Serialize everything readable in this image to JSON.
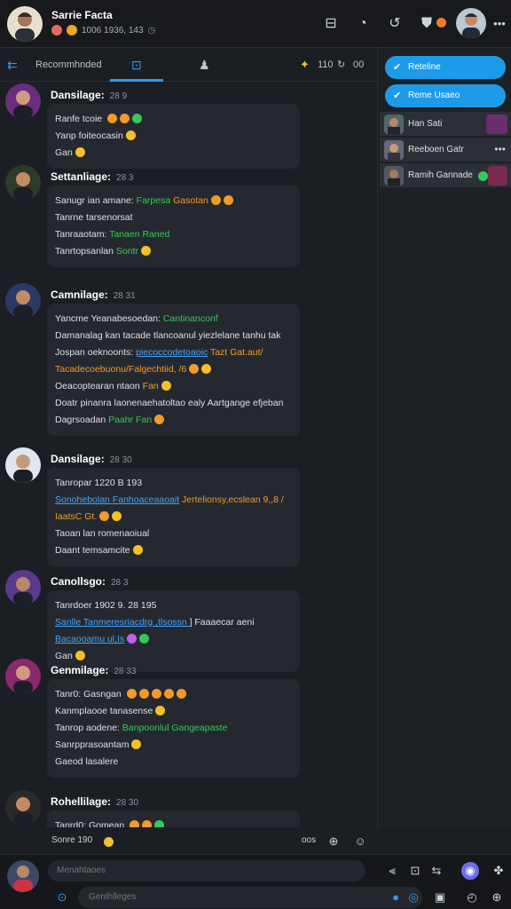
{
  "header": {
    "title": "Sarrie Facta",
    "subtitle": "1006 1936, 143",
    "icons": [
      "chat-icon",
      "bubble-icon",
      "share-icon",
      "reward-icon",
      "notification-badge-icon",
      "more-icon"
    ]
  },
  "subnav": {
    "back_label": "Recommhnded",
    "tab_active_icon": "box-icon",
    "tab2_icon": "person-icon",
    "stats": {
      "a": "110",
      "b": "00"
    }
  },
  "posts": [
    {
      "user": "Dansilage:",
      "time": "28 9",
      "lines": [
        {
          "parts": [
            {
              "t": "Ranfe tcoie "
            }
          ],
          "emojis": [
            "#f39a2a",
            "#f39a2a",
            "#35c85a"
          ]
        },
        {
          "parts": [
            {
              "t": "Yanp foiteocasin"
            }
          ],
          "emojis": [
            "#f3c12a"
          ]
        },
        {
          "parts": [
            {
              "t": "Gan"
            }
          ],
          "emojis": [
            "#f3c12a"
          ]
        }
      ]
    },
    {
      "user": "Settanliage:",
      "time": "28 3",
      "lines": [
        {
          "parts": [
            {
              "t": "Sanugr ian amane: "
            },
            {
              "t": "Farpesa",
              "c": "g"
            },
            {
              "t": " Gasotan",
              "c": "o"
            }
          ],
          "emojis": [
            "#f39a2a",
            "#f39a2a"
          ]
        },
        {
          "parts": [
            {
              "t": "Tanrne tarsenorsat"
            }
          ],
          "emojis": []
        },
        {
          "parts": [
            {
              "t": "Tanraaotam: "
            },
            {
              "t": "Tanaen Raned",
              "c": "g"
            }
          ],
          "emojis": []
        },
        {
          "parts": [
            {
              "t": "Tanrtopsanlan "
            },
            {
              "t": "Sontr",
              "c": "g"
            }
          ],
          "emojis": [
            "#f3c12a"
          ]
        }
      ]
    },
    {
      "user": "Camnilage:",
      "time": "28 31",
      "lines": [
        {
          "parts": [
            {
              "t": "Yancme Yeanabesoedan: "
            },
            {
              "t": "Cantinanconf",
              "c": "g"
            }
          ],
          "emojis": []
        },
        {
          "parts": [
            {
              "t": "Damanalag kan tacade tlancoanul yiezlelane tanhu tak"
            }
          ],
          "emojis": []
        },
        {
          "parts": [
            {
              "t": "Jospan oeknoonts: "
            },
            {
              "t": "piecoccodetoaoic",
              "c": "b"
            },
            {
              "t": " Tazt Gat.aut/",
              "c": "o"
            }
          ],
          "emojis": []
        },
        {
          "parts": [
            {
              "t": "Tacadecoebuonu/Falgechtiid, /6",
              "c": "o"
            }
          ],
          "emojis": [
            "#f39a2a",
            "#f3c12a"
          ]
        },
        {
          "parts": [
            {
              "t": "Oeacoptearan ntaon "
            },
            {
              "t": "Fan",
              "c": "o"
            }
          ],
          "emojis": [
            "#f3c12a"
          ]
        },
        {
          "parts": [
            {
              "t": "Doatr pinanra laonenaehatoltao ealy Aartgange efjeban"
            }
          ],
          "emojis": []
        },
        {
          "parts": [
            {
              "t": "Dagrsoadan "
            },
            {
              "t": "Paahr Fan",
              "c": "g"
            }
          ],
          "emojis": [
            "#f39a2a"
          ]
        }
      ]
    },
    {
      "user": "Dansilage:",
      "time": "28 30",
      "lines": [
        {
          "parts": [
            {
              "t": "Tanropar 1220 B 193"
            }
          ],
          "emojis": []
        },
        {
          "parts": [
            {
              "t": "Sonohebolan ",
              "c": "b"
            },
            {
              "t": "Fanhoaceaaoait",
              "c": "b"
            },
            {
              "t": " Jertelionsy,ecslean 9,,8 /",
              "c": "o"
            }
          ],
          "emojis": []
        },
        {
          "parts": [
            {
              "t": "IaatsC Gt.",
              "c": "o"
            }
          ],
          "emojis": [
            "#f39a2a",
            "#f3c12a"
          ]
        },
        {
          "parts": [
            {
              "t": "Taoan lan romenaoiual"
            }
          ],
          "emojis": []
        },
        {
          "parts": [
            {
              "t": "Daant temsamcite"
            }
          ],
          "emojis": [
            "#f3c12a"
          ]
        }
      ]
    },
    {
      "user": "Canollsgo:",
      "time": "28 3",
      "lines": [
        {
          "parts": [
            {
              "t": "Tanrdoer 1902 9. 28 195"
            }
          ],
          "emojis": []
        },
        {
          "parts": [
            {
              "t": "Sanlle ",
              "c": "b"
            },
            {
              "t": "Tanmeresriacdrg ,tlsossn ",
              "c": "b"
            },
            {
              "t": "] Faaaecar aeni",
              "c": ""
            }
          ],
          "emojis": []
        },
        {
          "parts": [
            {
              "t": "Bacaooamu ul,Is",
              "c": "b"
            }
          ],
          "emojis": [
            "#c060f0",
            "#35c85a"
          ]
        },
        {
          "parts": [
            {
              "t": "Gan"
            }
          ],
          "emojis": [
            "#f3c12a"
          ]
        }
      ]
    },
    {
      "user": "Genmilage:",
      "time": "28 33",
      "lines": [
        {
          "parts": [
            {
              "t": "Tanr0: Gasngan "
            }
          ],
          "emojis": [
            "#f39a2a",
            "#f39a2a",
            "#f39a2a",
            "#f39a2a",
            "#f39a2a"
          ]
        },
        {
          "parts": [
            {
              "t": "Kanmplaooe tanasense"
            }
          ],
          "emojis": [
            "#f3c12a"
          ]
        },
        {
          "parts": [
            {
              "t": "Tanrop aodene: "
            },
            {
              "t": "Banpoonlul Gangeapaste",
              "c": "g"
            }
          ],
          "emojis": []
        },
        {
          "parts": [
            {
              "t": "Sanrpprasoantam"
            }
          ],
          "emojis": [
            "#f3c12a"
          ]
        },
        {
          "parts": [
            {
              "t": "Gaeod lasalere"
            }
          ],
          "emojis": []
        }
      ]
    },
    {
      "user": "Rohellilage:",
      "time": "28 30",
      "lines": [
        {
          "parts": [
            {
              "t": "Tanrd0: Gomean "
            }
          ],
          "emojis": [
            "#f39a2a",
            "#f39a2a",
            "#35c85a"
          ]
        }
      ]
    }
  ],
  "sidebar": {
    "btn1": "Reteline",
    "btn2": "Reme Usaeo",
    "rows": [
      {
        "name": "Han Sati"
      },
      {
        "name": "Reeboen Gatr"
      },
      {
        "name": "Ramih Gannade"
      }
    ]
  },
  "typing": {
    "text": "Sonre 190",
    "right": "oos"
  },
  "composer": {
    "placeholder1": "Menahtaoes",
    "placeholder2": "Genthlleges"
  }
}
